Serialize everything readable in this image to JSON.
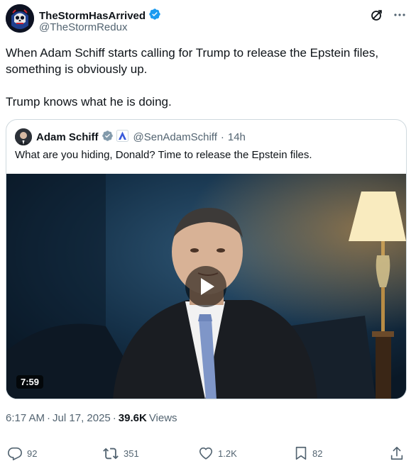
{
  "author": {
    "display_name": "TheStormHasArrived",
    "handle": "@TheStormRedux",
    "verified_badge_color": "#1d9bf0"
  },
  "header_icons": [
    "grok-icon",
    "more-icon"
  ],
  "tweet": {
    "line1": "When Adam Schiff starts calling for Trump to release the Epstein files,",
    "line2": "something is obviously up.",
    "line3": "Trump knows what he is doing."
  },
  "quote": {
    "display_name": "Adam Schiff",
    "handle": "@SenAdamSchiff",
    "separator": "·",
    "time": "14h",
    "text": "What are you hiding, Donald? Time to release the Epstein files.",
    "video_duration": "7:59"
  },
  "meta": {
    "time": "6:17 AM",
    "separator1": "·",
    "date": "Jul 17, 2025",
    "separator2": "·",
    "views_count": "39.6K",
    "views_label": "Views"
  },
  "actions": {
    "replies": "92",
    "reposts": "351",
    "likes": "1.2K",
    "bookmarks": "82"
  },
  "colors": {
    "text_primary": "#0f1419",
    "text_secondary": "#536471",
    "border": "#cfd9de",
    "verified": "#1d9bf0",
    "gov_badge": "#829aab"
  }
}
